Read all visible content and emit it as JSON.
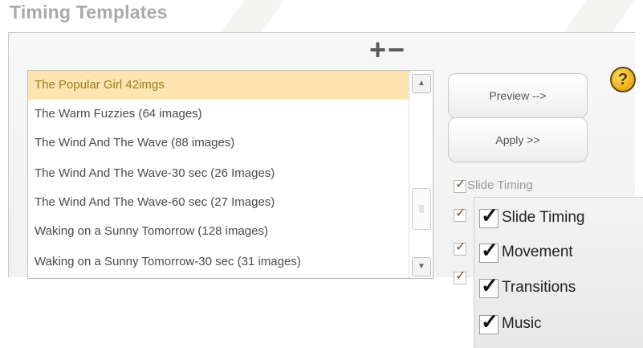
{
  "section_title": "Timing Templates",
  "toolbar": {
    "add_label": "+",
    "remove_label": "−"
  },
  "help": {
    "label": "?"
  },
  "templates": {
    "items": [
      "The Popular Girl 42imgs",
      "The Warm Fuzzies (64 images)",
      "The Wind And The Wave (88 images)",
      "The Wind And The Wave-30 sec (26 Images)",
      "The Wind And The Wave-60 sec (27 Images)",
      "Waking on a Sunny Tomorrow (128 images)",
      "Waking on a Sunny Tomorrow-30 sec (31 images)"
    ],
    "selected": "The Popular Girl 42imgs"
  },
  "buttons": {
    "preview": "Preview -->",
    "apply": "Apply >>"
  },
  "options_small": {
    "label_0": "Slide Timing",
    "checkmark": "✓"
  },
  "options_popup": {
    "checkmark": "✓",
    "items": [
      "Slide Timing",
      "Movement",
      "Transitions",
      "Music"
    ]
  },
  "colors": {
    "selected_row_bg": "#fde4b0",
    "selected_row_text": "#a07a1e",
    "help_icon": "#f2b21c",
    "title": "#a9a9a9"
  }
}
